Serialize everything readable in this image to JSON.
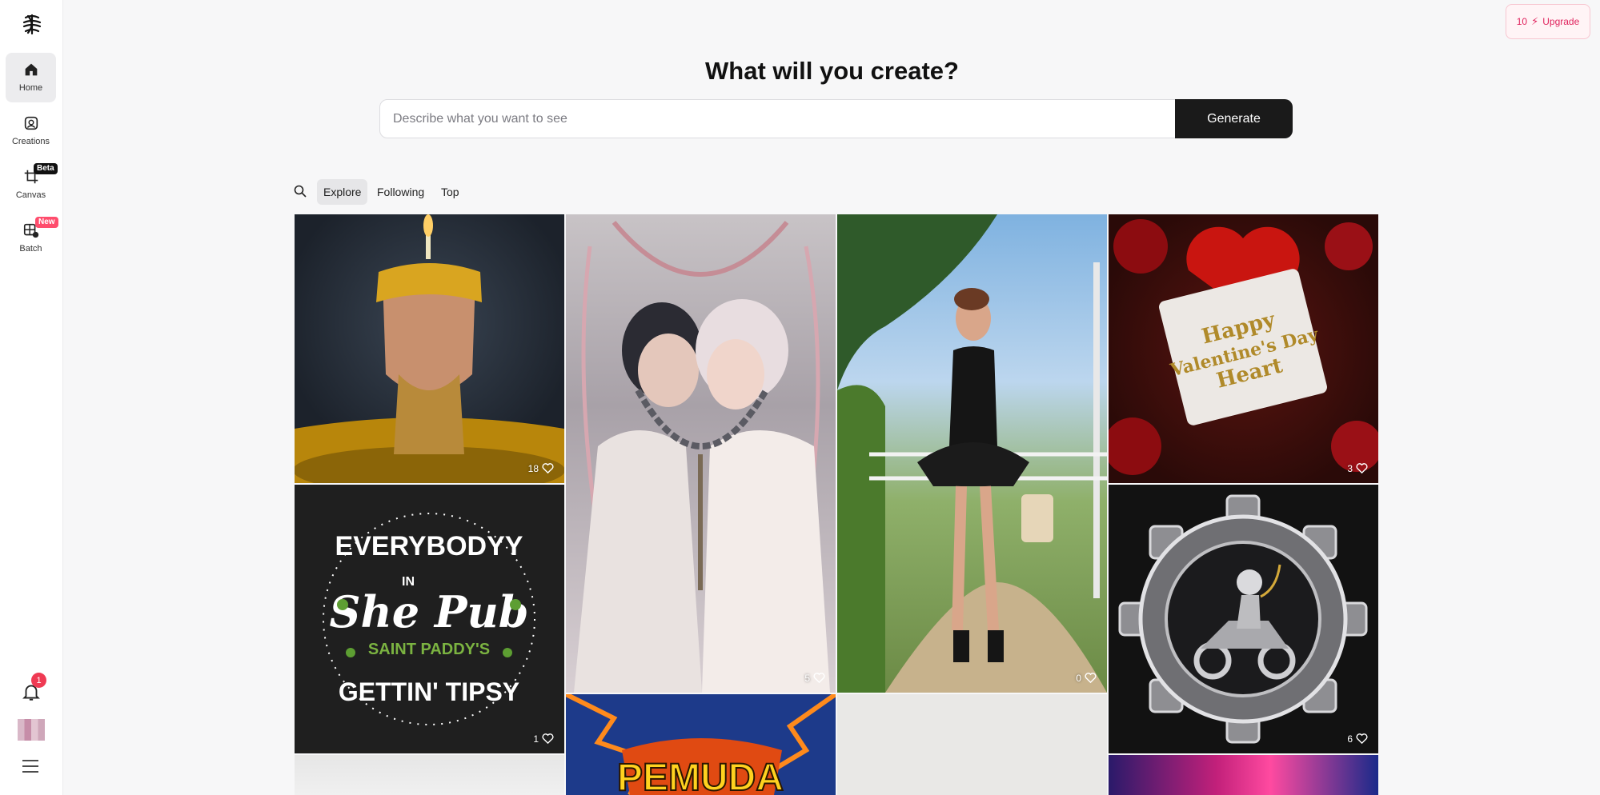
{
  "sidebar": {
    "items": [
      {
        "label": "Home",
        "icon": "home-icon"
      },
      {
        "label": "Creations",
        "icon": "image-icon"
      },
      {
        "label": "Canvas",
        "icon": "canvas-icon",
        "badge": "Beta"
      },
      {
        "label": "Batch",
        "icon": "batch-icon",
        "badge": "New"
      }
    ],
    "notifications": "1"
  },
  "upgrade": {
    "credits": "10",
    "label": "Upgrade"
  },
  "header": {
    "title": "What will you create?"
  },
  "search": {
    "placeholder": "Describe what you want to see",
    "value": "",
    "button": "Generate"
  },
  "tabs": [
    "Explore",
    "Following",
    "Top"
  ],
  "gallery": {
    "likes": [
      "18",
      "3",
      "5",
      "0",
      "1",
      "6"
    ],
    "tile_text": {
      "valentine_line1": "Happy",
      "valentine_line2": "Valentine's Day",
      "valentine_line3": "Heart",
      "pub_top": "EVERYBODYY",
      "pub_in": "IN",
      "pub_main": "She Pub",
      "pub_sub": "SAINT PADDY'S",
      "pub_bottom": "GETTIN' TIPSY",
      "pemuda": "PEMUDA"
    }
  },
  "colors": {
    "accent": "#e0245e",
    "button_dark": "#1a1a1a",
    "badge_red": "#ef3a53"
  }
}
